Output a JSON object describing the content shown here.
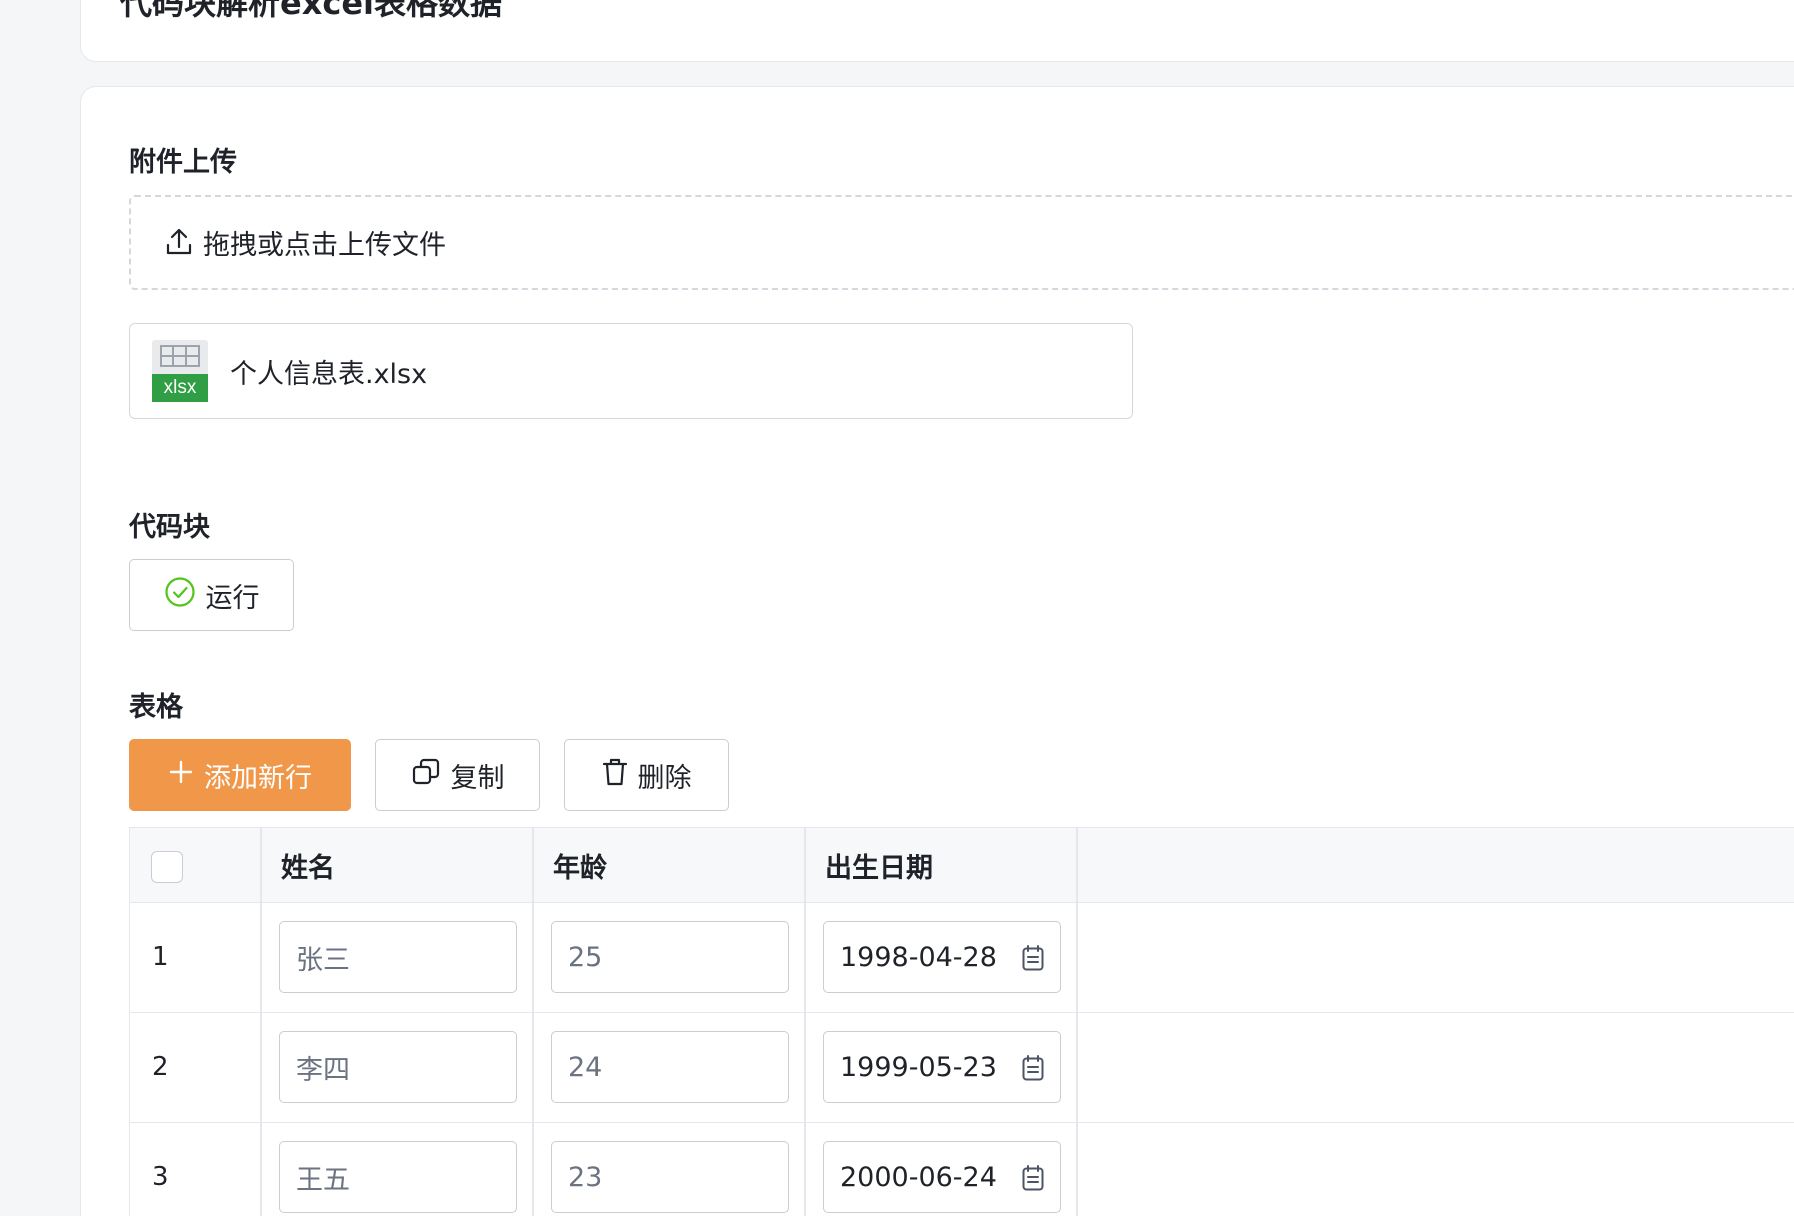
{
  "page": {
    "title": "代码块解析excel表格数据"
  },
  "upload": {
    "section_label": "附件上传",
    "dropzone_text": "拖拽或点击上传文件",
    "file": {
      "badge": "xlsx",
      "name": "个人信息表.xlsx"
    }
  },
  "code": {
    "section_label": "代码块",
    "run_label": "运行"
  },
  "table": {
    "section_label": "表格",
    "actions": {
      "add": "添加新行",
      "copy": "复制",
      "delete": "删除"
    },
    "columns": [
      "姓名",
      "年龄",
      "出生日期"
    ],
    "rows": [
      {
        "index": "1",
        "name": "张三",
        "age": "25",
        "birth": "1998-04-28"
      },
      {
        "index": "2",
        "name": "李四",
        "age": "24",
        "birth": "1999-05-23"
      },
      {
        "index": "3",
        "name": "王五",
        "age": "23",
        "birth": "2000-06-24"
      }
    ]
  },
  "colors": {
    "primary": "#f0974a",
    "success": "#52c41a",
    "excel": "#2f9e44"
  }
}
